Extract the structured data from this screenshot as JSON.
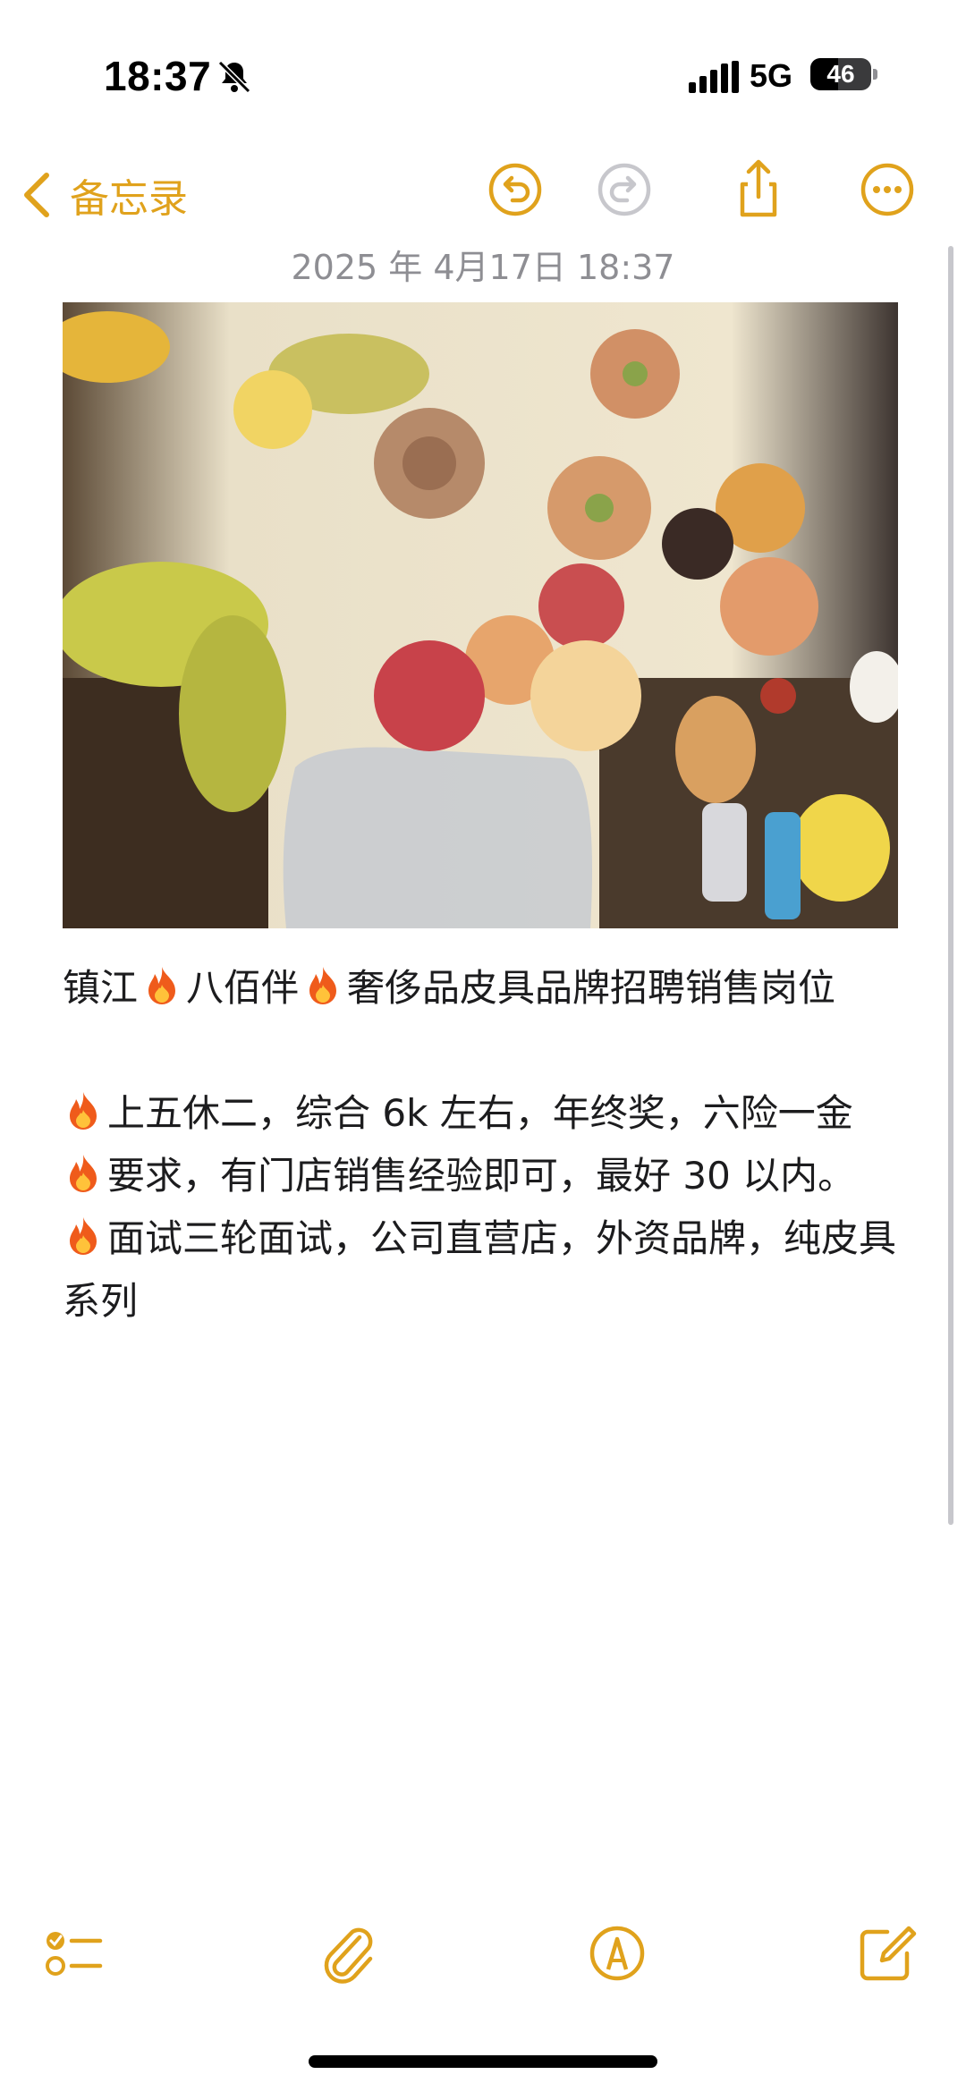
{
  "status_bar": {
    "time": "18:37",
    "silent_icon": "bell-slash-icon",
    "signal_icon": "cellular-signal-icon",
    "network": "5G",
    "battery_level": "46",
    "battery_fraction": 0.46
  },
  "nav": {
    "back_label": "备忘录",
    "back_icon": "chevron-left-icon",
    "undo_icon": "undo-icon",
    "redo_icon": "redo-icon",
    "share_icon": "share-icon",
    "more_icon": "ellipsis-circle-icon"
  },
  "note": {
    "date": "2025 年 4月17日 18:37",
    "photo_icon": "flower-bouquet-photo",
    "line1": [
      "镇江",
      "八佰伴",
      "奢侈品皮具品牌招聘销售岗位"
    ],
    "item1": "上五休二，综合 6k 左右，年终奖，六险一金",
    "item2": "要求，有门店销售经验即可，最好 30 以内。",
    "item3": "面试三轮面试，公司直营店，外资品牌，纯皮具系列",
    "bullet_icon": "fire-emoji-icon"
  },
  "toolbar": {
    "checklist_icon": "checklist-icon",
    "attach_icon": "paperclip-icon",
    "markup_icon": "markup-pen-icon",
    "compose_icon": "compose-icon"
  },
  "colors": {
    "accent": "#E0A21C",
    "disabled": "#c7c7cc",
    "date_gray": "#8e8e93",
    "text": "#1c1c1e"
  }
}
